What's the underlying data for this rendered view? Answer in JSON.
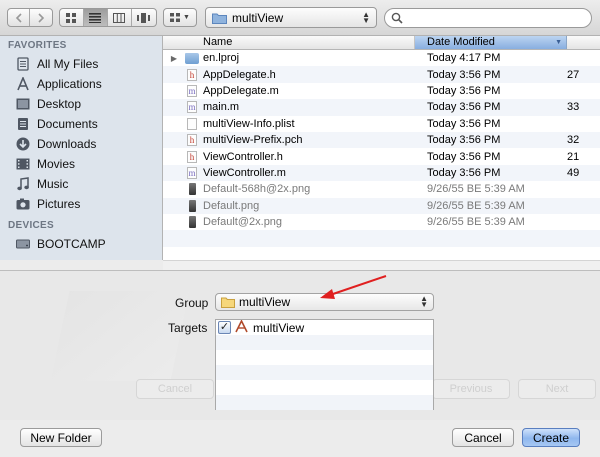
{
  "toolbar": {
    "location_popup": "multiView",
    "search_placeholder": ""
  },
  "sidebar": {
    "favorites_header": "FAVORITES",
    "favorites": [
      {
        "label": "All My Files",
        "icon": "all-files-icon"
      },
      {
        "label": "Applications",
        "icon": "applications-icon"
      },
      {
        "label": "Desktop",
        "icon": "desktop-icon"
      },
      {
        "label": "Documents",
        "icon": "documents-icon"
      },
      {
        "label": "Downloads",
        "icon": "downloads-icon"
      },
      {
        "label": "Movies",
        "icon": "movies-icon"
      },
      {
        "label": "Music",
        "icon": "music-icon"
      },
      {
        "label": "Pictures",
        "icon": "pictures-icon"
      }
    ],
    "devices_header": "DEVICES",
    "devices": [
      {
        "label": "BOOTCAMP",
        "icon": "drive-icon"
      }
    ]
  },
  "file_list": {
    "columns": {
      "name": "Name",
      "date": "Date Modified"
    },
    "rows": [
      {
        "name": "en.lproj",
        "date": "Today 4:17 PM",
        "size": "",
        "kind": "folder"
      },
      {
        "name": "AppDelegate.h",
        "date": "Today 3:56 PM",
        "size": "27",
        "kind": "h"
      },
      {
        "name": "AppDelegate.m",
        "date": "Today 3:56 PM",
        "size": "",
        "kind": "m"
      },
      {
        "name": "main.m",
        "date": "Today 3:56 PM",
        "size": "33",
        "kind": "m"
      },
      {
        "name": "multiView-Info.plist",
        "date": "Today 3:56 PM",
        "size": "",
        "kind": "doc"
      },
      {
        "name": "multiView-Prefix.pch",
        "date": "Today 3:56 PM",
        "size": "32",
        "kind": "h"
      },
      {
        "name": "ViewController.h",
        "date": "Today 3:56 PM",
        "size": "21",
        "kind": "h"
      },
      {
        "name": "ViewController.m",
        "date": "Today 3:56 PM",
        "size": "49",
        "kind": "m"
      },
      {
        "name": "Default-568h@2x.png",
        "date": "9/26/55 BE 5:39 AM",
        "size": "",
        "kind": "png"
      },
      {
        "name": "Default.png",
        "date": "9/26/55 BE 5:39 AM",
        "size": "",
        "kind": "png"
      },
      {
        "name": "Default@2x.png",
        "date": "9/26/55 BE 5:39 AM",
        "size": "",
        "kind": "png"
      }
    ]
  },
  "options": {
    "group_label": "Group",
    "group_value": "multiView",
    "targets_label": "Targets",
    "targets": [
      {
        "label": "multiView",
        "checked": true
      }
    ],
    "ghost_buttons": {
      "cancel": "Cancel",
      "previous": "Previous",
      "next": "Next"
    }
  },
  "buttons": {
    "new_folder": "New Folder",
    "cancel": "Cancel",
    "create": "Create"
  },
  "colors": {
    "annotation_arrow": "#e02020",
    "sidebar_bg": "#dde4ec",
    "primary_button": "#8fb7ee"
  }
}
